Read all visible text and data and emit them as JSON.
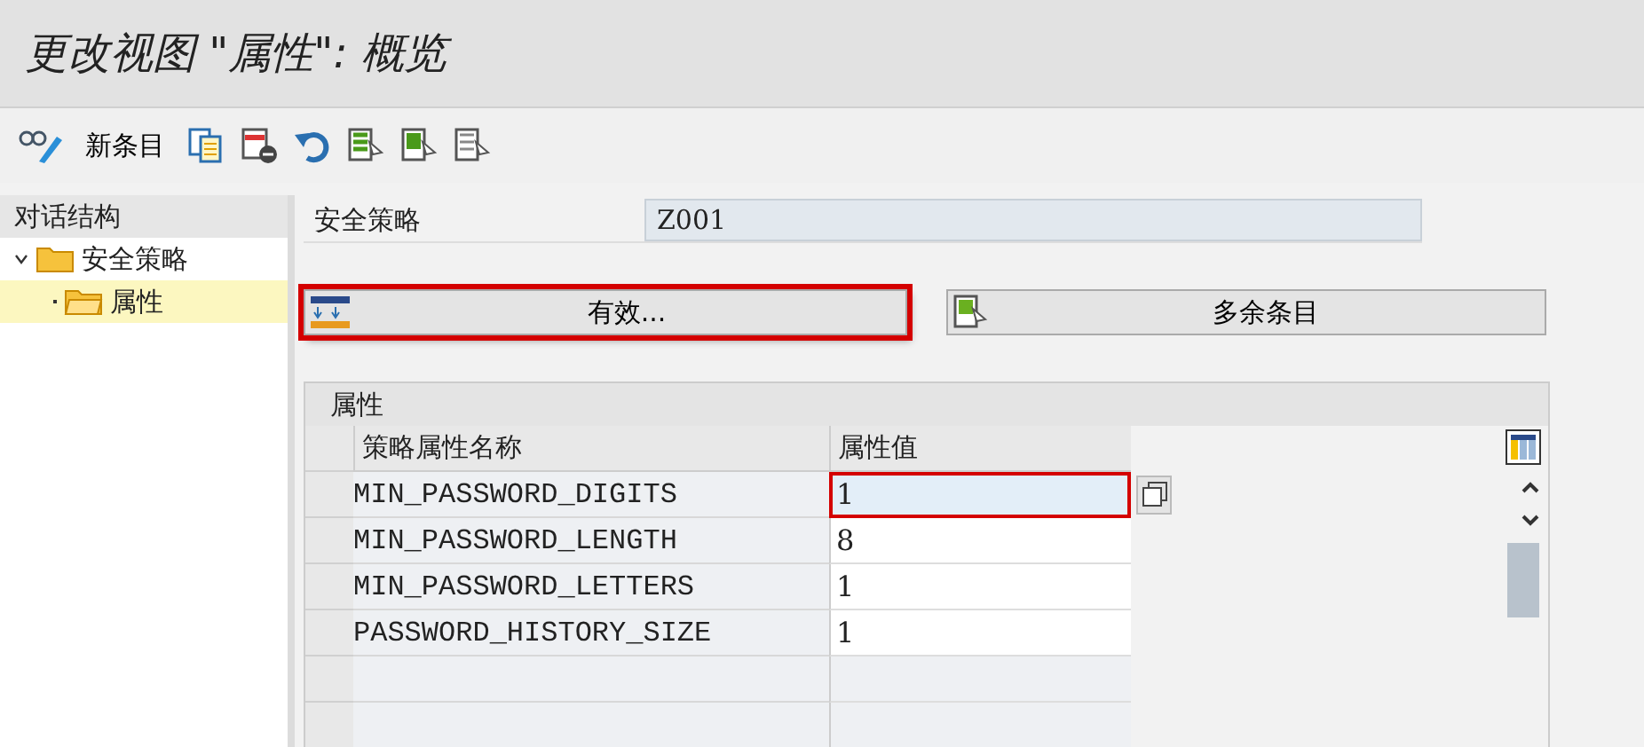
{
  "window": {
    "title": "更改视图 \"属性\": 概览"
  },
  "toolbar": {
    "new_entries_label": "新条目"
  },
  "dialog_structure": {
    "title": "对话结构",
    "items": [
      {
        "label": "安全策略",
        "expanded": true,
        "selected": false,
        "children": [
          {
            "label": "属性",
            "selected": true
          }
        ]
      }
    ]
  },
  "header_field": {
    "label": "安全策略",
    "value": "Z001"
  },
  "buttons": [
    {
      "label": "有效...",
      "highlighted": true
    },
    {
      "label": "多余条目",
      "highlighted": false
    }
  ],
  "table": {
    "title": "属性",
    "columns": [
      "策略属性名称",
      "属性值"
    ],
    "rows": [
      {
        "name": "MIN_PASSWORD_DIGITS",
        "value": "1",
        "selected": true
      },
      {
        "name": "MIN_PASSWORD_LENGTH",
        "value": "8",
        "selected": false
      },
      {
        "name": "MIN_PASSWORD_LETTERS",
        "value": "1",
        "selected": false
      },
      {
        "name": "PASSWORD_HISTORY_SIZE",
        "value": "1",
        "selected": false
      }
    ]
  }
}
